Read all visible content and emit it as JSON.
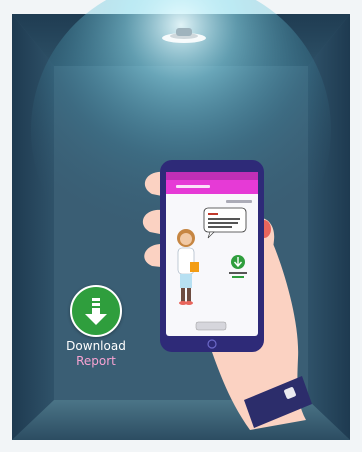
{
  "colors": {
    "room_back": "#35546a",
    "room_side": "#2b4a61",
    "room_floor": "#3e6479",
    "frame": "#f2f5f7",
    "phone_body": "#2e2a78",
    "app_bar": "#e63ad6",
    "download_green": "#2f9e3d",
    "report_pink": "#f7a3d3",
    "skin": "#fbd2c2",
    "nail": "#e8655c"
  },
  "cta": {
    "icon": "download-arrow-icon",
    "line1": "Download",
    "line2": "Report"
  },
  "phone": {
    "status_bar": "",
    "app_title": "",
    "speech_text": "",
    "mini_download_label": "",
    "bottom_button": ""
  }
}
